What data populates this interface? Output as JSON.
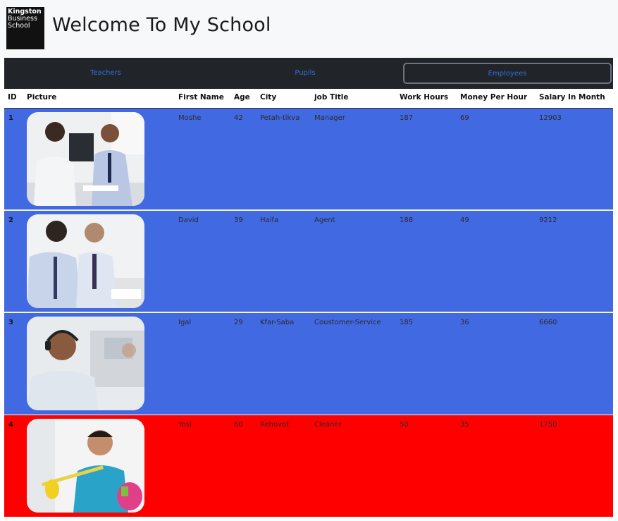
{
  "header": {
    "logo": {
      "line1": "Kingston",
      "line2": "Business",
      "line3": "School"
    },
    "title": "Welcome To My School"
  },
  "nav": {
    "tabs": [
      {
        "label": "Teachers",
        "active": false
      },
      {
        "label": "Pupils",
        "active": false
      },
      {
        "label": "Employees",
        "active": true
      }
    ]
  },
  "table": {
    "columns": [
      "ID",
      "Picture",
      "First Name",
      "Age",
      "City",
      "job Title",
      "Work Hours",
      "Money Per Hour",
      "Salary In Month"
    ],
    "rows": [
      {
        "id": "1",
        "picture": "office-meeting-photo",
        "first_name": "Moshe",
        "age": "42",
        "city": "Petah-tikva",
        "job_title": "Manager",
        "work_hours": "187",
        "money_per_hour": "69",
        "salary_in_month": "12903",
        "row_color": "#4169e1"
      },
      {
        "id": "2",
        "picture": "business-discussion-photo",
        "first_name": "David",
        "age": "39",
        "city": "Haifa",
        "job_title": "Agent",
        "work_hours": "188",
        "money_per_hour": "49",
        "salary_in_month": "9212",
        "row_color": "#4169e1"
      },
      {
        "id": "3",
        "picture": "headset-support-photo",
        "first_name": "Igal",
        "age": "29",
        "city": "Kfar-Saba",
        "job_title": "Coustomer-Service",
        "work_hours": "185",
        "money_per_hour": "36",
        "salary_in_month": "6660",
        "row_color": "#4169e1"
      },
      {
        "id": "4",
        "picture": "cleaner-photo",
        "first_name": "Yosi",
        "age": "60",
        "city": "Rehovot",
        "job_title": "Cleaner",
        "work_hours": "50",
        "money_per_hour": "35",
        "salary_in_month": "1750",
        "row_color": "#ff0000"
      }
    ]
  },
  "colors": {
    "nav_bg": "#212529",
    "nav_link": "#2f6fe0",
    "row_blue": "#4169e1",
    "row_red": "#ff0000"
  }
}
